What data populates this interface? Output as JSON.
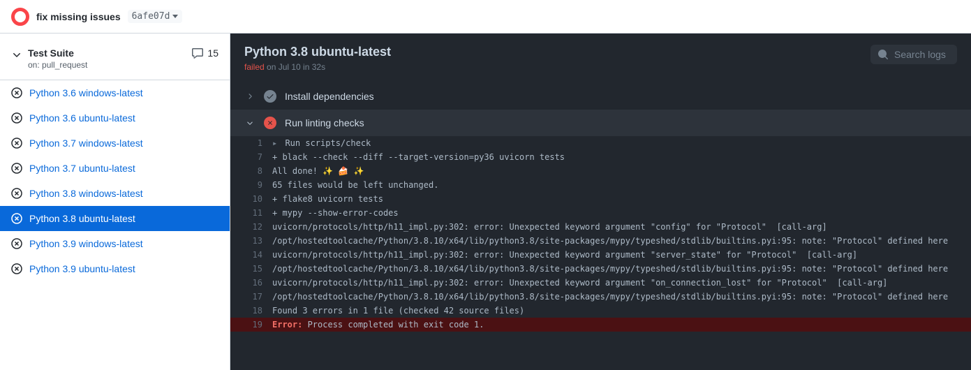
{
  "header": {
    "title": "fix missing issues",
    "commit": "6afe07d"
  },
  "workflow": {
    "name": "Test Suite",
    "trigger": "on: pull_request",
    "count": "15"
  },
  "jobs": [
    {
      "name": "Python 3.6 windows-latest",
      "status": "fail",
      "active": false
    },
    {
      "name": "Python 3.6 ubuntu-latest",
      "status": "fail",
      "active": false
    },
    {
      "name": "Python 3.7 windows-latest",
      "status": "fail",
      "active": false
    },
    {
      "name": "Python 3.7 ubuntu-latest",
      "status": "fail",
      "active": false
    },
    {
      "name": "Python 3.8 windows-latest",
      "status": "fail",
      "active": false
    },
    {
      "name": "Python 3.8 ubuntu-latest",
      "status": "fail",
      "active": true
    },
    {
      "name": "Python 3.9 windows-latest",
      "status": "fail",
      "active": false
    },
    {
      "name": "Python 3.9 ubuntu-latest",
      "status": "fail",
      "active": false
    }
  ],
  "currentJob": {
    "title": "Python 3.8 ubuntu-latest",
    "status": "failed",
    "timing": " on Jul 10 in 32s"
  },
  "search": {
    "placeholder": "Search logs"
  },
  "steps": {
    "install": {
      "label": "Install dependencies"
    },
    "lint": {
      "label": "Run linting checks"
    }
  },
  "logs": [
    {
      "n": "1",
      "t": "Run scripts/check",
      "caret": true
    },
    {
      "n": "7",
      "t": "+ black --check --diff --target-version=py36 uvicorn tests"
    },
    {
      "n": "8",
      "t": "All done! ✨ 🍰 ✨"
    },
    {
      "n": "9",
      "t": "65 files would be left unchanged."
    },
    {
      "n": "10",
      "t": "+ flake8 uvicorn tests"
    },
    {
      "n": "11",
      "t": "+ mypy --show-error-codes"
    },
    {
      "n": "12",
      "t": "uvicorn/protocols/http/h11_impl.py:302: error: Unexpected keyword argument \"config\" for \"Protocol\"  [call-arg]"
    },
    {
      "n": "13",
      "t": "/opt/hostedtoolcache/Python/3.8.10/x64/lib/python3.8/site-packages/mypy/typeshed/stdlib/builtins.pyi:95: note: \"Protocol\" defined here"
    },
    {
      "n": "14",
      "t": "uvicorn/protocols/http/h11_impl.py:302: error: Unexpected keyword argument \"server_state\" for \"Protocol\"  [call-arg]"
    },
    {
      "n": "15",
      "t": "/opt/hostedtoolcache/Python/3.8.10/x64/lib/python3.8/site-packages/mypy/typeshed/stdlib/builtins.pyi:95: note: \"Protocol\" defined here"
    },
    {
      "n": "16",
      "t": "uvicorn/protocols/http/h11_impl.py:302: error: Unexpected keyword argument \"on_connection_lost\" for \"Protocol\"  [call-arg]"
    },
    {
      "n": "17",
      "t": "/opt/hostedtoolcache/Python/3.8.10/x64/lib/python3.8/site-packages/mypy/typeshed/stdlib/builtins.pyi:95: note: \"Protocol\" defined here"
    },
    {
      "n": "18",
      "t": "Found 3 errors in 1 file (checked 42 source files)"
    },
    {
      "n": "19",
      "err": "Error:",
      "t": " Process completed with exit code 1.",
      "error": true
    }
  ]
}
